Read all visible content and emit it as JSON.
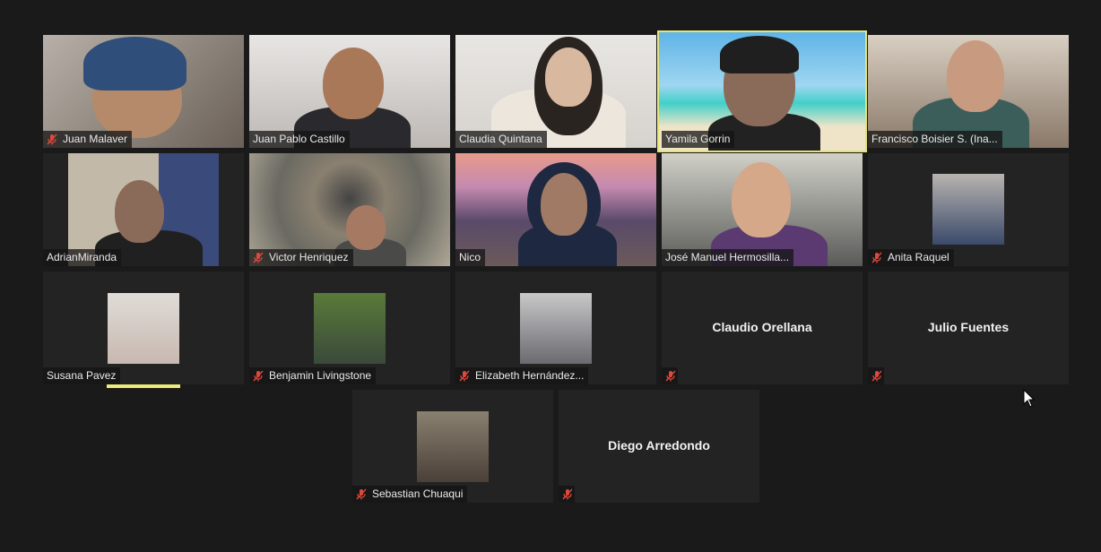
{
  "participants": [
    {
      "name": "Juan Malaver"
    },
    {
      "name": "Juan Pablo Castillo"
    },
    {
      "name": "Claudia Quintana"
    },
    {
      "name": "Yamila Gorrin"
    },
    {
      "name": "Francisco Boisier S. (Ina..."
    },
    {
      "name": "AdrianMiranda"
    },
    {
      "name": "Victor Henriquez"
    },
    {
      "name": "Nico"
    },
    {
      "name": "José Manuel Hermosilla..."
    },
    {
      "name": "Anita Raquel"
    },
    {
      "name": "Susana Pavez"
    },
    {
      "name": "Benjamin Livingstone"
    },
    {
      "name": "Elizabeth Hernández..."
    },
    {
      "name": "Claudio Orellana"
    },
    {
      "name": "Julio Fuentes"
    },
    {
      "name": "Sebastian Chuaqui"
    },
    {
      "name": "Diego Arredondo"
    }
  ],
  "colors": {
    "active_speaker": "#e5e47a",
    "mute_icon": "#e0483e"
  }
}
